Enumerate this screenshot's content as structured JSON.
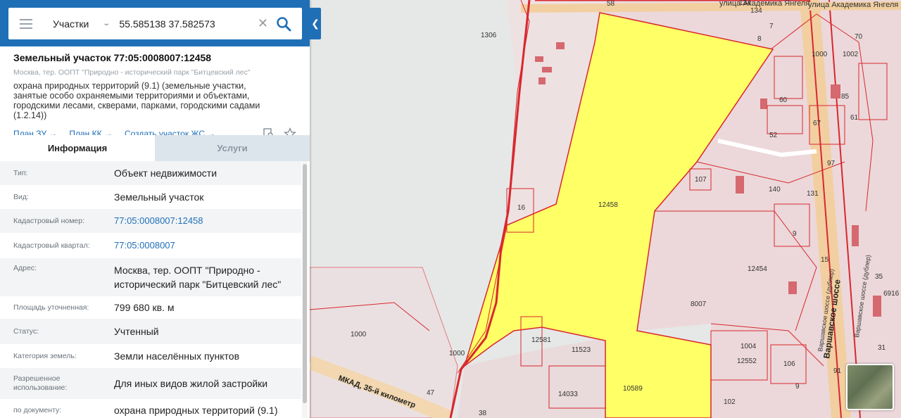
{
  "search": {
    "layer": "Участки",
    "query": "55.585138 37.582573"
  },
  "parcel": {
    "title": "Земельный участок 77:05:0008007:12458",
    "subtitle": "Москва, тер. ООПТ \"Природно - исторический парк \"Битцевский лес\"",
    "usage": "охрана природных территорий (9.1) (земельные участки, занятые особо охраняемыми территориями и объектами, городскими лесами, скверами, парками, городскими садами (1.2.14))"
  },
  "links": {
    "plan_zu": "План ЗУ",
    "plan_kk": "План КК",
    "create_js": "Создать участок ЖС"
  },
  "tabs": {
    "info": "Информация",
    "services": "Услуги"
  },
  "rows": [
    {
      "label": "Тип:",
      "value": "Объект недвижимости"
    },
    {
      "label": "Вид:",
      "value": "Земельный участок"
    },
    {
      "label": "Кадастровый номер:",
      "value": "77:05:0008007:12458"
    },
    {
      "label": "Кадастровый квартал:",
      "value": "77:05:0008007"
    },
    {
      "label": "Адрес:",
      "value": "Москва, тер. ООПТ \"Природно - исторический парк \"Битцевский лес\""
    },
    {
      "label": "Площадь уточненная:",
      "value": "799 680 кв. м"
    },
    {
      "label": "Статус:",
      "value": "Учтенный"
    },
    {
      "label": "Категория земель:",
      "value": "Земли населённых пунктов"
    },
    {
      "label": "Разрешенное использование:",
      "value": "Для иных видов жилой застройки"
    },
    {
      "label": "по документу:",
      "value": "охрана природных территорий (9.1)"
    }
  ],
  "map": {
    "streets": {
      "yangel": "улица Академика Янгеля",
      "yangel2": "улица Академика Янгеля",
      "varsh": "Варшавское шоссе",
      "varsh_dubler1": "Варшавское шоссе (дублер)",
      "varsh_dubler2": "Варшавское шоссе (дублер)",
      "mkad": "МКАД, 35-й километр"
    },
    "labels": [
      "1306",
      "58",
      "134",
      "7",
      "8",
      "70",
      "1002",
      "1000",
      "60",
      "85",
      "67",
      "52",
      "61",
      "97",
      "107",
      "140",
      "131",
      "12458",
      "16",
      "9",
      "15",
      "12454",
      "35",
      "8007",
      "1000",
      "1000",
      "12581",
      "11523",
      "1004",
      "12552",
      "106",
      "10589",
      "14033",
      "47",
      "38",
      "102",
      "9",
      "91",
      "6916",
      "31",
      "134"
    ],
    "colors": {
      "parcel": "#ffff66",
      "boundary": "#d9272e",
      "road": "#f6d9a8",
      "forest": "#e6e8e7"
    }
  }
}
